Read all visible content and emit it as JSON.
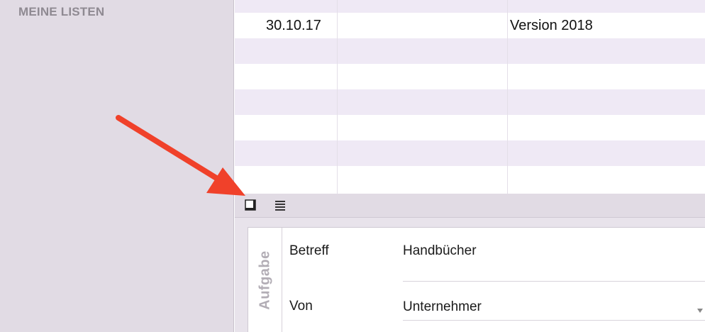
{
  "sidebar": {
    "title": "MEINE LISTEN"
  },
  "list": {
    "rows": [
      {
        "date": "30.10.17",
        "name": "",
        "title": "Version 2018"
      }
    ]
  },
  "toolbar": {
    "icons": [
      "single-window-icon",
      "list-view-icon"
    ]
  },
  "detail": {
    "tab_label": "Aufgabe",
    "fields": {
      "subject_label": "Betreff",
      "subject_value": "Handbücher",
      "from_label": "Von",
      "from_value": "Unternehmer"
    }
  },
  "annotation": {
    "arrow_color": "#f0412a"
  },
  "colors": {
    "sidebar_bg": "#e1dbe4",
    "stripe": "#efe9f5",
    "tab_label": "#b2adb5"
  }
}
